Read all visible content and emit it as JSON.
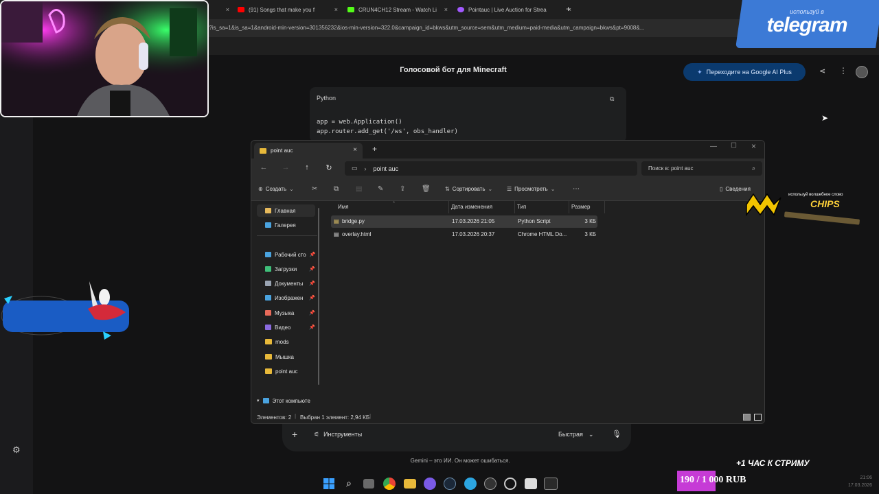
{
  "browser": {
    "tabs": [
      {
        "label": "(91) Songs that make you f",
        "favicon_color": "#ff0000"
      },
      {
        "label": "CRUN4CH12 Stream - Watch Li",
        "favicon_color": "#53fc18"
      },
      {
        "label": "Pointauc | Live Auction for Strea",
        "favicon_color": "#a259ff"
      }
    ],
    "new_tab": "+",
    "url": "d?is_sa=1&is_sa=1&android-min-version=301356232&ios-min-version=322.0&campaign_id=bkws&utm_source=sem&utm_medium=paid-media&utm_campaign=bkws&pt=9008&..."
  },
  "gemini": {
    "chat_title": "Голосовой бот для Minecraft",
    "upgrade_button": "Переходите на Google AI Plus",
    "code_language": "Python",
    "code_lines": [
      "app = web.Application()",
      "app.router.add_get('/ws', obs_handler)"
    ],
    "tools_label": "Инструменты",
    "model_label": "Быстрая",
    "disclaimer": "Gemini – это ИИ. Он может ошибаться."
  },
  "explorer": {
    "tab_title": "point auc",
    "path": "point auc",
    "search_placeholder": "Поиск в: point auc",
    "commands": {
      "create": "Создать",
      "sort": "Сортировать",
      "view": "Просмотреть",
      "details": "Сведения"
    },
    "nav": [
      {
        "label": "Главная",
        "pinned": false,
        "color": "#e6b95c"
      },
      {
        "label": "Галерея",
        "pinned": false,
        "color": "#4aa3df"
      },
      {
        "label": "Рабочий сто",
        "pinned": true,
        "color": "#4aa3df"
      },
      {
        "label": "Загрузки",
        "pinned": true,
        "color": "#3fbf7a"
      },
      {
        "label": "Документы",
        "pinned": true,
        "color": "#9aa4b2"
      },
      {
        "label": "Изображен",
        "pinned": true,
        "color": "#4aa3df"
      },
      {
        "label": "Музыка",
        "pinned": true,
        "color": "#e86a5a"
      },
      {
        "label": "Видео",
        "pinned": true,
        "color": "#8a6adf"
      },
      {
        "label": "mods",
        "pinned": false,
        "color": "#e8b93a"
      },
      {
        "label": "Мышка",
        "pinned": false,
        "color": "#e8b93a"
      },
      {
        "label": "point auc",
        "pinned": false,
        "color": "#e8b93a"
      },
      {
        "label": "Этот компьюте",
        "pinned": false,
        "color": "#4aa3df"
      }
    ],
    "pin_glyph": "📌",
    "columns": {
      "name": "Имя",
      "date": "Дата изменения",
      "type": "Тип",
      "size": "Размер"
    },
    "files": [
      {
        "name": "bridge.py",
        "date": "17.03.2026 21:05",
        "type": "Python Script",
        "size": "3 КБ",
        "selected": true
      },
      {
        "name": "overlay.html",
        "date": "17.03.2026 20:37",
        "type": "Chrome HTML Do...",
        "size": "3 КБ",
        "selected": false
      }
    ],
    "status": {
      "count": "Элементов: 2",
      "selection": "Выбран 1 элемент: 2,94 КБ"
    }
  },
  "overlays": {
    "telegram_small": "используй в",
    "telegram_big": "telegram",
    "chips_small": "используй волшебное слово",
    "chips_big": "CHIPS",
    "stream_timer": "+1 ЧАС К СТРИМУ",
    "donation_goal": "190 / 1 000 RUB",
    "clock_time": "21:06",
    "clock_date": "17.03.2026"
  },
  "colors": {
    "accent": "#0b3a6e",
    "telegram": "#3c7ad6",
    "donation": "#c63bd6"
  }
}
